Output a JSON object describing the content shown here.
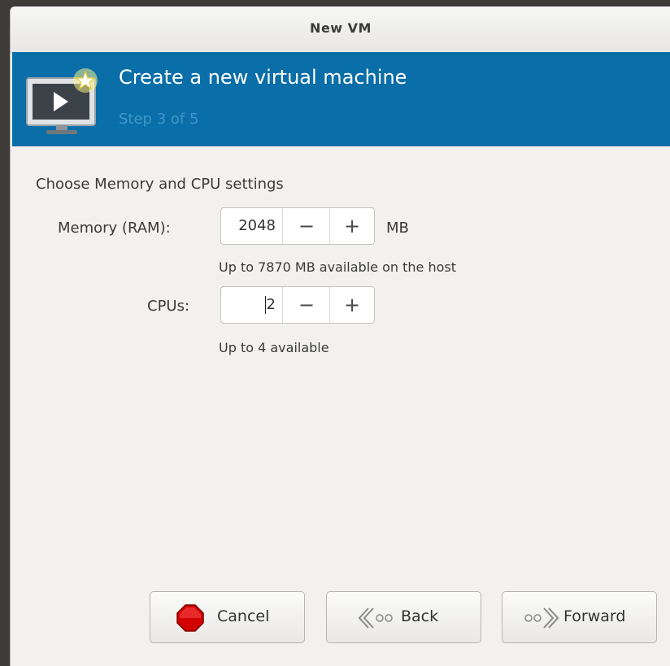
{
  "window": {
    "title": "New VM"
  },
  "banner": {
    "heading": "Create a new virtual machine",
    "step": "Step 3 of 5",
    "icon": "vm-monitor-new-icon"
  },
  "settings": {
    "section_title": "Choose Memory and CPU settings",
    "memory": {
      "label": "Memory (RAM):",
      "value": "2048",
      "unit": "MB",
      "hint": "Up to 7870 MB available on the host",
      "decrement": "−",
      "increment": "+"
    },
    "cpus": {
      "label": "CPUs:",
      "value": "2",
      "hint": "Up to 4 available",
      "decrement": "−",
      "increment": "+"
    }
  },
  "buttons": {
    "cancel": {
      "label": "Cancel",
      "icon": "stop-sign-icon"
    },
    "back": {
      "label": "Back",
      "icon": "back-arrow-icon"
    },
    "forward": {
      "label": "Forward",
      "icon": "forward-arrow-icon"
    }
  },
  "colors": {
    "banner": "#0a6ea8",
    "step_text": "#3f97c9",
    "cancel_icon": "#d40000"
  }
}
